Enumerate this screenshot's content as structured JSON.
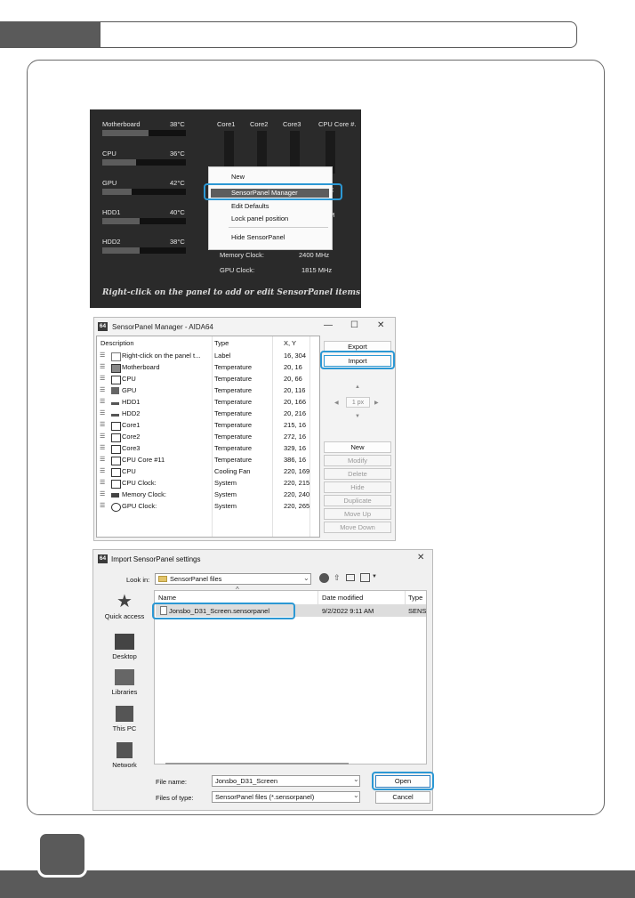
{
  "sensor_panel": {
    "left_items": [
      {
        "name": "Motherboard",
        "value": "38°C",
        "fill": 0.55
      },
      {
        "name": "CPU",
        "value": "36°C",
        "fill": 0.4
      },
      {
        "name": "GPU",
        "value": "42°C",
        "fill": 0.35
      },
      {
        "name": "HDD1",
        "value": "40°C",
        "fill": 0.45
      },
      {
        "name": "HDD2",
        "value": "38°C",
        "fill": 0.45
      }
    ],
    "cores": [
      "Core1",
      "Core2",
      "Core3",
      "CPU Core #."
    ],
    "clocks": [
      {
        "name": "Memory Clock:",
        "value": "2400 MHz"
      },
      {
        "name": "GPU Clock:",
        "value": "1815 MHz"
      }
    ],
    "partial_value_c": "C",
    "partial_value_m": "M",
    "partial_value_z": "z",
    "footer": "Right-click on the panel to add or edit SensorPanel items",
    "context_menu": [
      "New",
      "SensorPanel Manager",
      "Edit Defaults",
      "Lock panel position",
      "Hide SensorPanel"
    ]
  },
  "manager": {
    "logo": "64",
    "title": "SensorPanel Manager - AIDA64",
    "columns": [
      "Description",
      "Type",
      "X, Y"
    ],
    "rows": [
      {
        "desc": "Right-click on the panel t...",
        "type": "Label",
        "xy": "16, 304",
        "icon": "label-icon"
      },
      {
        "desc": "Motherboard",
        "type": "Temperature",
        "xy": "20, 16",
        "icon": "motherboard-icon"
      },
      {
        "desc": "CPU",
        "type": "Temperature",
        "xy": "20, 66",
        "icon": "cpu-icon"
      },
      {
        "desc": "GPU",
        "type": "Temperature",
        "xy": "20, 116",
        "icon": "gpu-icon"
      },
      {
        "desc": "HDD1",
        "type": "Temperature",
        "xy": "20, 166",
        "icon": "hdd-icon"
      },
      {
        "desc": "HDD2",
        "type": "Temperature",
        "xy": "20, 216",
        "icon": "hdd-icon"
      },
      {
        "desc": "Core1",
        "type": "Temperature",
        "xy": "215, 16",
        "icon": "cpu-icon"
      },
      {
        "desc": "Core2",
        "type": "Temperature",
        "xy": "272, 16",
        "icon": "cpu-icon"
      },
      {
        "desc": "Core3",
        "type": "Temperature",
        "xy": "329, 16",
        "icon": "cpu-icon"
      },
      {
        "desc": "CPU Core #11",
        "type": "Temperature",
        "xy": "386, 16",
        "icon": "cpu-icon"
      },
      {
        "desc": "CPU",
        "type": "Cooling Fan",
        "xy": "220, 169",
        "icon": "cpu-icon"
      },
      {
        "desc": "CPU Clock:",
        "type": "System",
        "xy": "220, 215",
        "icon": "cpu-icon"
      },
      {
        "desc": "Memory Clock:",
        "type": "System",
        "xy": "220, 240",
        "icon": "memory-icon"
      },
      {
        "desc": "GPU Clock:",
        "type": "System",
        "xy": "220, 265",
        "icon": "clock-icon"
      }
    ],
    "buttons": {
      "export": "Export",
      "import": "Import",
      "step": "1 px",
      "new": "New",
      "modify": "Modify",
      "delete": "Delete",
      "hide": "Hide",
      "duplicate": "Duplicate",
      "move_up": "Move Up",
      "move_down": "Move Down"
    }
  },
  "import_dialog": {
    "logo": "64",
    "title": "Import SensorPanel settings",
    "look_in_label": "Look in:",
    "look_in_value": "SensorPanel files",
    "places": [
      "Quick access",
      "Desktop",
      "Libraries",
      "This PC",
      "Network"
    ],
    "columns": [
      "Name",
      "Date modified",
      "Type"
    ],
    "file": {
      "name": "Jonsbo_D31_Screen.sensorpanel",
      "date": "9/2/2022 9:11 AM",
      "type": "SENS"
    },
    "file_name_label": "File name:",
    "file_name_value": "Jonsbo_D31_Screen",
    "file_type_label": "Files of type:",
    "file_type_value": "SensorPanel files (*.sensorpanel)",
    "open": "Open",
    "cancel": "Cancel"
  }
}
